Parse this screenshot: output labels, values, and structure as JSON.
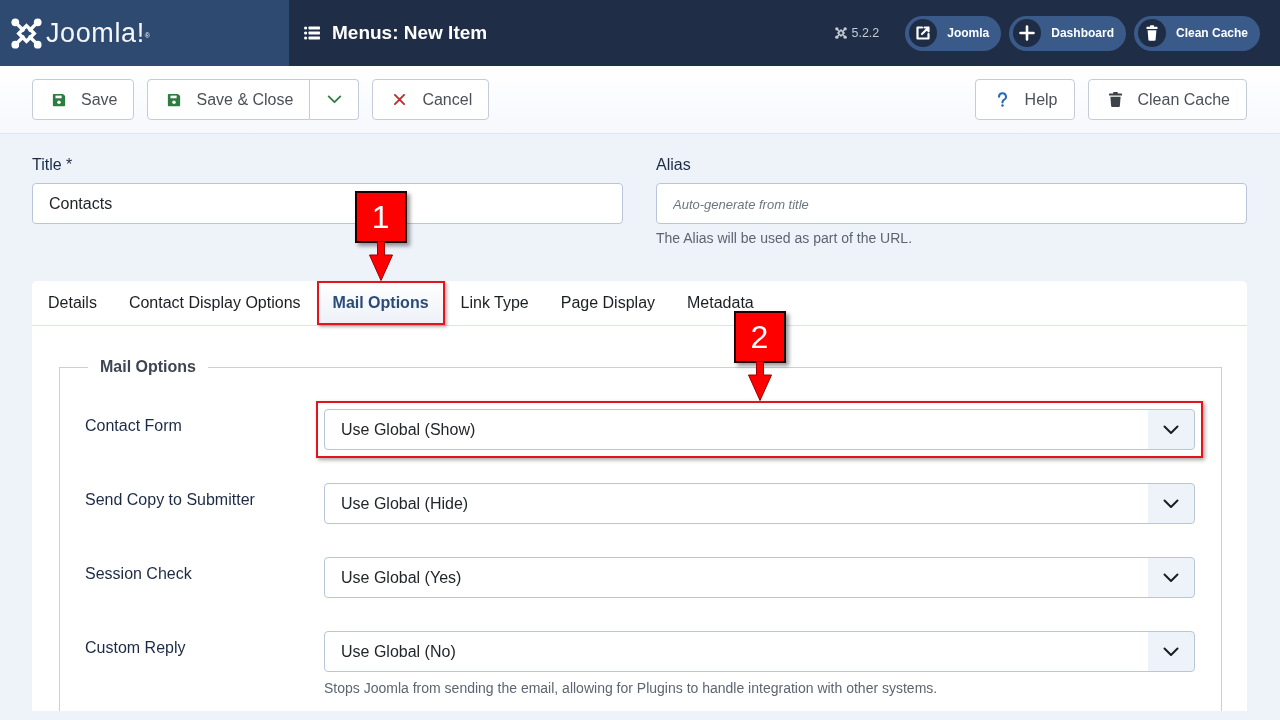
{
  "header": {
    "logo": "Joomla!$^{®}$",
    "title": "Menus: New Item",
    "version": "5.2.2",
    "links": [
      {
        "kind": "external",
        "label": "Joomla"
      },
      {
        "kind": "add",
        "label": "Dashboard"
      },
      {
        "kind": "trash",
        "label": "Clean Cache"
      }
    ]
  },
  "toolbar": {
    "left": [
      {
        "kind": "save",
        "label": "Save",
        "dropdown": false
      },
      {
        "kind": "save-close",
        "label": "Save & Close",
        "dropdown": true
      },
      {
        "kind": "cancel",
        "label": "Cancel",
        "dropdown": false
      }
    ],
    "right": [
      {
        "kind": "help",
        "label": "Help",
        "dropdown": false
      },
      {
        "kind": "trash",
        "label": "Clean Cache",
        "dropdown": false
      }
    ]
  },
  "title_field": {
    "label": "Title *",
    "value": "Contacts"
  },
  "alias_field": {
    "label": "Alias",
    "placeholder": "Auto-generate from title",
    "help": "The Alias will be used as part of the URL."
  },
  "tabs": [
    {
      "label": "Details",
      "selected": false,
      "highlighted": false
    },
    {
      "label": "Contact Display Options",
      "selected": false,
      "highlighted": false
    },
    {
      "label": "Mail Options",
      "selected": true,
      "highlighted": true,
      "callout": "1"
    },
    {
      "label": "Link Type",
      "selected": false,
      "highlighted": false
    },
    {
      "label": "Page Display",
      "selected": false,
      "highlighted": false
    },
    {
      "label": "Metadata",
      "selected": false,
      "highlighted": false
    }
  ],
  "fieldset": {
    "legend": "Mail Options",
    "fields": [
      {
        "label": "Contact Form",
        "value": "Use Global (Show)",
        "highlighted": true,
        "callout": "2"
      },
      {
        "label": "Send Copy to Submitter",
        "value": "Use Global (Hide)",
        "highlighted": false
      },
      {
        "label": "Session Check",
        "value": "Use Global (Yes)",
        "highlighted": false
      },
      {
        "label": "Custom Reply",
        "value": "Use Global (No)",
        "highlighted": false,
        "help": "Stops Joomla from sending the email, allowing for Plugins to handle integration with other systems."
      }
    ]
  }
}
